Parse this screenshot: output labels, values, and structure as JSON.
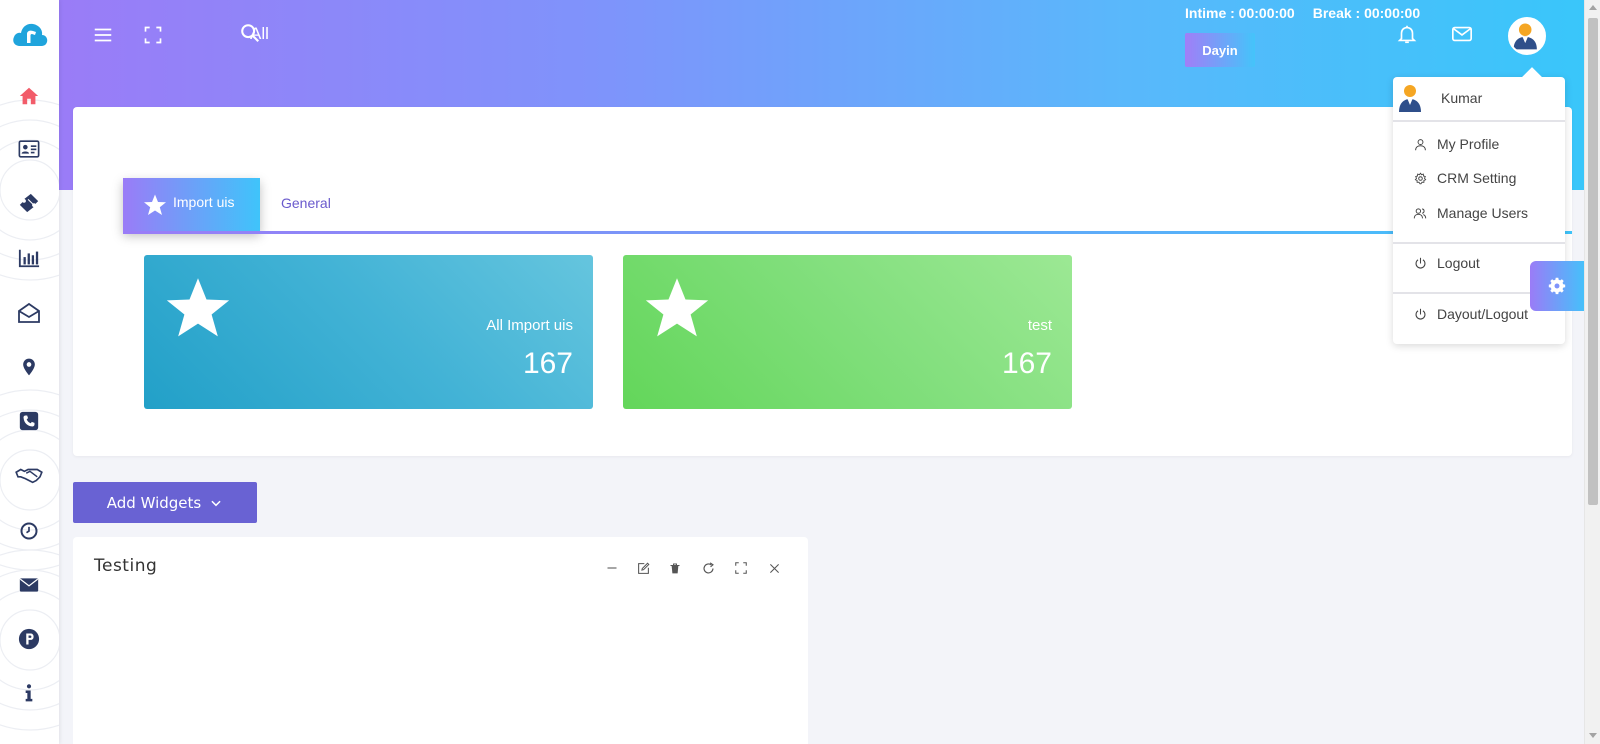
{
  "header": {
    "all_label": "All",
    "intime": "Intime : 00:00:00",
    "break": "Break : 00:00:00",
    "dayin_label": "Dayin"
  },
  "tabs": {
    "active_label": "Import uis",
    "general_label": "General"
  },
  "stats": [
    {
      "label": "All Import uis",
      "value": "167",
      "color": "#22a0c8"
    },
    {
      "label": "test",
      "value": "167",
      "color": "#63d65a"
    }
  ],
  "add_widgets_label": "Add Widgets",
  "widget": {
    "title": "Testing",
    "tools": [
      "minimize-icon",
      "edit-icon",
      "trash-icon",
      "refresh-icon",
      "expand-icon",
      "close-icon"
    ]
  },
  "dropdown": {
    "username": "Kumar",
    "items": [
      {
        "label": "My Profile",
        "icon": "user-icon"
      },
      {
        "label": "CRM Setting",
        "icon": "gear-icon"
      },
      {
        "label": "Manage Users",
        "icon": "users-icon"
      },
      {
        "label": "Logout",
        "icon": "power-icon"
      },
      {
        "label": "Dayout/Logout",
        "icon": "power-icon"
      }
    ]
  },
  "sidebar": {
    "icons": [
      "home-icon",
      "contact-card-icon",
      "ticket-icon",
      "bar-chart-icon",
      "envelope-open-icon",
      "location-pin-icon",
      "phone-icon",
      "handshake-icon",
      "clock-icon",
      "mail-icon",
      "parking-icon",
      "info-icon"
    ]
  },
  "colors": {
    "accent": "#6962d3",
    "gradient_start": "#9a7cf7",
    "gradient_end": "#39c6fa",
    "home_icon": "#f25c6a",
    "sidebar_icon": "#2c3a63"
  }
}
